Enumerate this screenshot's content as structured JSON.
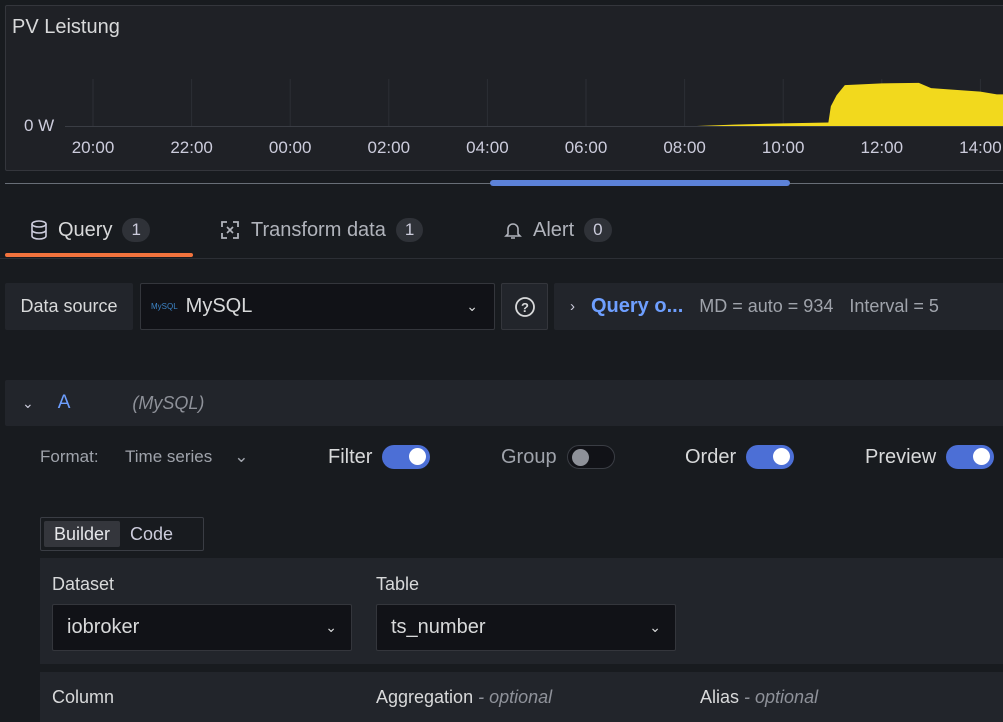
{
  "panel": {
    "title": "PV Leistung",
    "chart_data": {
      "type": "area",
      "title": "PV Leistung",
      "y_tick_labels": [
        "0 W"
      ],
      "x_tick_labels": [
        "20:00",
        "22:00",
        "00:00",
        "02:00",
        "04:00",
        "06:00",
        "08:00",
        "10:00",
        "12:00",
        "14:00"
      ],
      "x": [
        "08:15",
        "09:00",
        "10:00",
        "10:55",
        "10:58",
        "11:05",
        "11:15",
        "12:00",
        "12:45",
        "13:00",
        "13:30",
        "14:00",
        "14:20"
      ],
      "values_relative": [
        0,
        0.03,
        0.06,
        0.08,
        0.45,
        0.7,
        0.93,
        0.97,
        0.98,
        0.86,
        0.82,
        0.78,
        0.72
      ],
      "grid": true,
      "color": "#f2d91d"
    }
  },
  "tabs": [
    {
      "label": "Query",
      "count": "1",
      "icon": "database-icon"
    },
    {
      "label": "Transform data",
      "count": "1",
      "icon": "transform-icon"
    },
    {
      "label": "Alert",
      "count": "0",
      "icon": "bell-icon"
    }
  ],
  "datasource": {
    "label": "Data source",
    "value": "MySQL",
    "logo_text": "MySQL"
  },
  "query_options": {
    "label": "Query o...",
    "md": "MD = auto = 934",
    "interval": "Interval = 5"
  },
  "query": {
    "ref": "A",
    "source": "(MySQL)",
    "format_label": "Format:",
    "format_value": "Time series",
    "toggles": [
      {
        "label": "Filter",
        "on": true
      },
      {
        "label": "Group",
        "on": false
      },
      {
        "label": "Order",
        "on": true
      },
      {
        "label": "Preview",
        "on": true
      }
    ],
    "modes": [
      "Builder",
      "Code"
    ],
    "active_mode": "Builder",
    "dataset_label": "Dataset",
    "dataset_value": "iobroker",
    "table_label": "Table",
    "table_value": "ts_number",
    "column_label": "Column",
    "aggregation_label": "Aggregation",
    "alias_label": "Alias",
    "optional": "- optional"
  },
  "colors": {
    "accent": "#4c6fd6",
    "tab_underline": "#f2733d",
    "series": "#f2d91d",
    "link": "#6e9fff"
  }
}
